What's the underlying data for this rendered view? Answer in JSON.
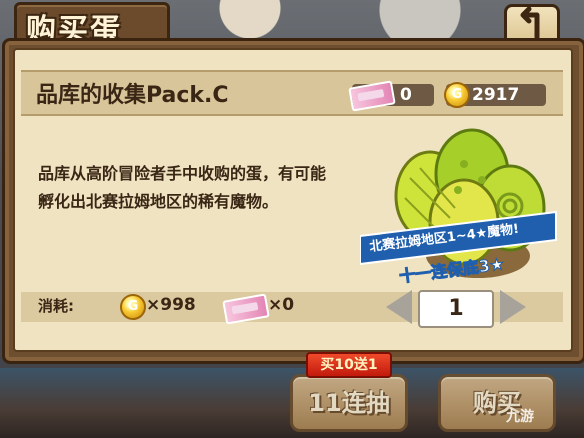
{
  "header": {
    "title": "购买蛋",
    "back_icon": "back-arrow-icon"
  },
  "pack": {
    "name": "品库的收集Pack.C",
    "ticket_count": "0",
    "gold_count": "2917",
    "coin_glyph": "G",
    "description": "品库从高阶冒险者手中收购的蛋，有可能孵化出北赛拉姆地区的稀有魔物。"
  },
  "egg_art": {
    "banner_line1": "北赛拉姆地区1~4★魔物!",
    "banner_line2": "十一连保底3★"
  },
  "cost": {
    "label": "消耗:",
    "gold": "×998",
    "ticket": "×0"
  },
  "quantity": {
    "value": "1"
  },
  "actions": {
    "promo_badge": "买10送1",
    "draw11_label": "11连抽",
    "buy_label": "购买"
  },
  "watermark": {
    "text": "九游"
  },
  "colors": {
    "frame": "#6d4e2f",
    "panel": "#efe3c2",
    "text": "#3a2614",
    "promo": "#e0331f"
  }
}
